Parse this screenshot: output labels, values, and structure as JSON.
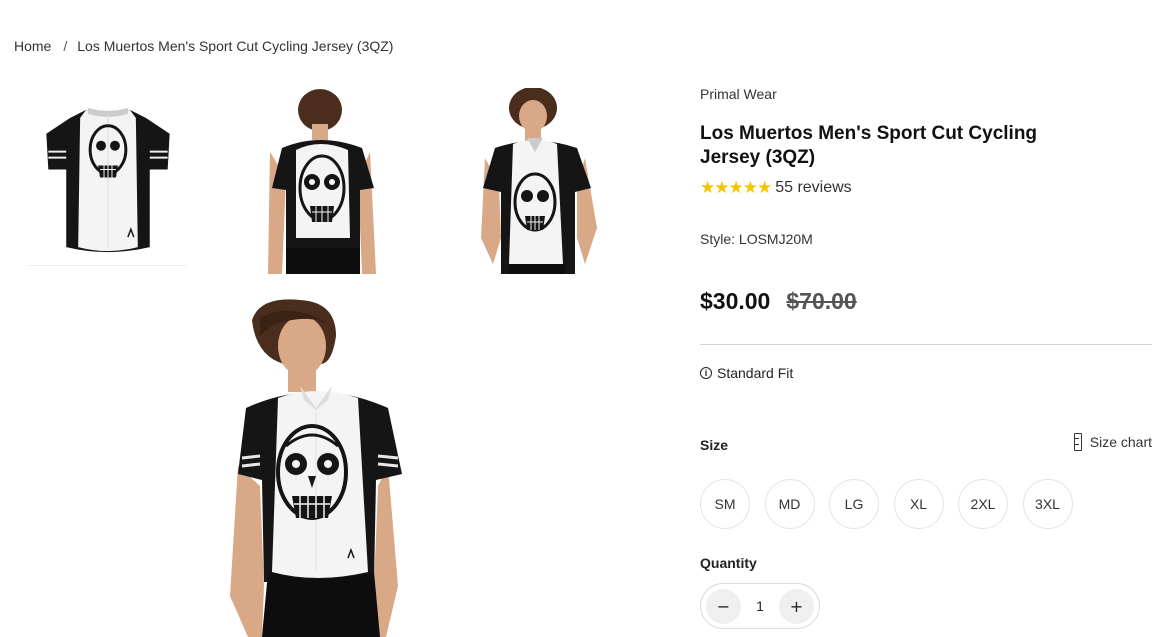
{
  "breadcrumb": {
    "home": "Home",
    "separator": "/",
    "current": "Los Muertos Men's Sport Cut Cycling Jersey (3QZ)"
  },
  "gallery": {
    "thumbnails": [
      {
        "name": "jersey-flat-front"
      },
      {
        "name": "model-back"
      },
      {
        "name": "model-front"
      }
    ],
    "main": {
      "name": "model-front-large"
    }
  },
  "product": {
    "brand": "Primal Wear",
    "title": "Los Muertos Men's Sport Cut Cycling Jersey (3QZ)",
    "rating": {
      "stars": 5,
      "stars_text": "★★★★★",
      "reviews": "55 reviews"
    },
    "style": "Style: LOSMJ20M",
    "price": {
      "current": "$30.00",
      "original": "$70.00"
    },
    "fit": {
      "icon": "info-icon",
      "label": "Standard Fit"
    },
    "size": {
      "label": "Size",
      "chart_label": "Size chart",
      "chart_icon": "ruler-icon",
      "options": [
        "SM",
        "MD",
        "LG",
        "XL",
        "2XL",
        "3XL"
      ]
    },
    "quantity": {
      "label": "Quantity",
      "value": "1",
      "minus": "−",
      "plus": "+"
    }
  },
  "colors": {
    "star": "#f5c400",
    "text": "#222222",
    "jersey_black": "#151515",
    "jersey_white": "#f4f4f4",
    "skin": "#d9a887",
    "hair": "#4a2d1c"
  }
}
